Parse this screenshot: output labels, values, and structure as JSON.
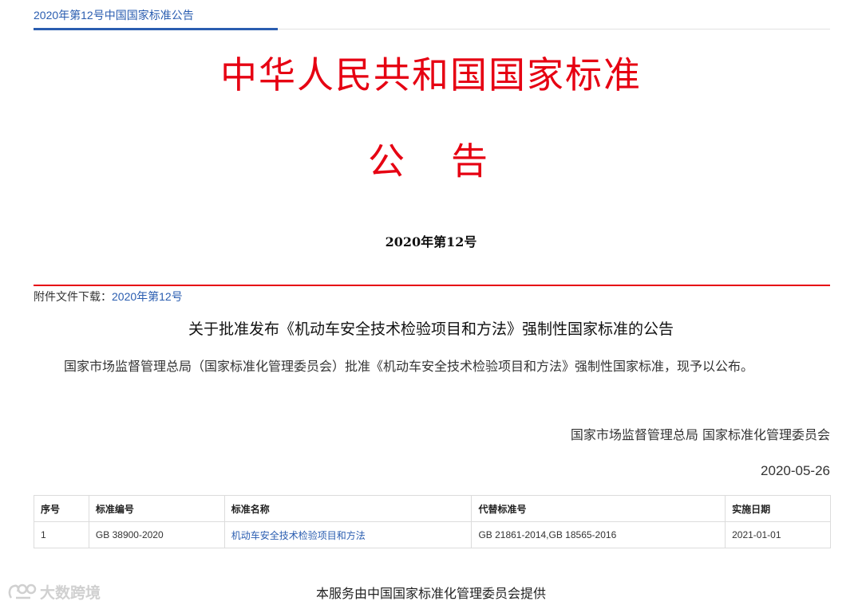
{
  "header": {
    "title": "2020年第12号中国国家标准公告"
  },
  "notice": {
    "main_title": "中华人民共和国国家标准",
    "sub_title": "公告",
    "number": "2020年第12号"
  },
  "attachment": {
    "label": "附件文件下载：",
    "link_text": "2020年第12号"
  },
  "document": {
    "title": "关于批准发布《机动车安全技术检验项目和方法》强制性国家标准的公告",
    "body": "国家市场监督管理总局（国家标准化管理委员会）批准《机动车安全技术检验项目和方法》强制性国家标准，现予以公布。",
    "signer": "国家市场监督管理总局 国家标准化管理委员会",
    "date": "2020-05-26"
  },
  "table": {
    "headers": [
      "序号",
      "标准编号",
      "标准名称",
      "代替标准号",
      "实施日期"
    ],
    "rows": [
      [
        "1",
        "GB 38900-2020",
        "机动车安全技术检验项目和方法",
        "GB 21861-2014,GB 18565-2016",
        "2021-01-01"
      ]
    ]
  },
  "footer": {
    "text": "本服务由中国国家标准化管理委员会提供"
  },
  "watermark": {
    "text": "大数跨境",
    "icon": "watermark-logo-icon"
  },
  "colors": {
    "red": "#e60012",
    "blue": "#2a5db0"
  }
}
